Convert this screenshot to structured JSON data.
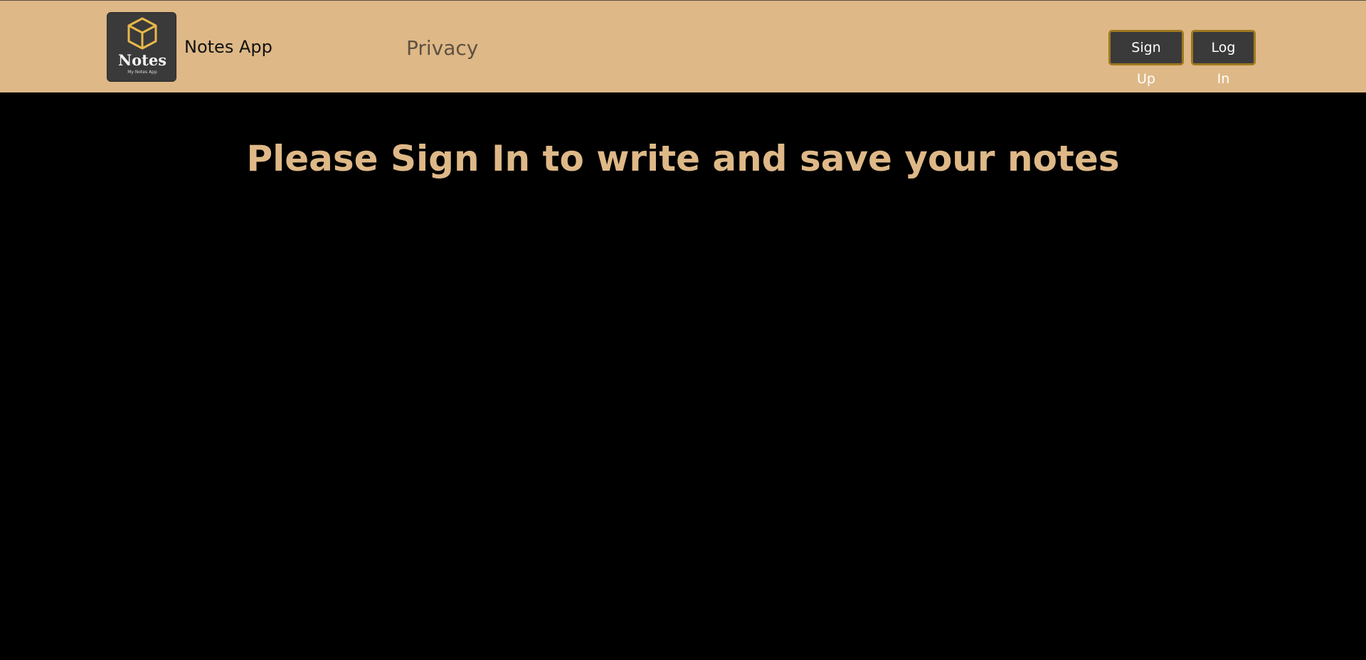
{
  "navbar": {
    "brand_name": "Notes App",
    "logo": {
      "icon": "cube-icon",
      "title": "Notes",
      "subtitle": "My Notes App"
    },
    "links": [
      {
        "label": "Privacy"
      }
    ],
    "signup_label": "Sign Up",
    "login_label": "Log In"
  },
  "main": {
    "heading": "Please Sign In to write and save your notes"
  },
  "colors": {
    "navbar_bg": "#DEB887",
    "page_bg": "#000000",
    "accent": "#DEB887",
    "button_bg": "#3a3a3a",
    "button_border": "#A0781E",
    "logo_cube": "#E8B84A"
  }
}
